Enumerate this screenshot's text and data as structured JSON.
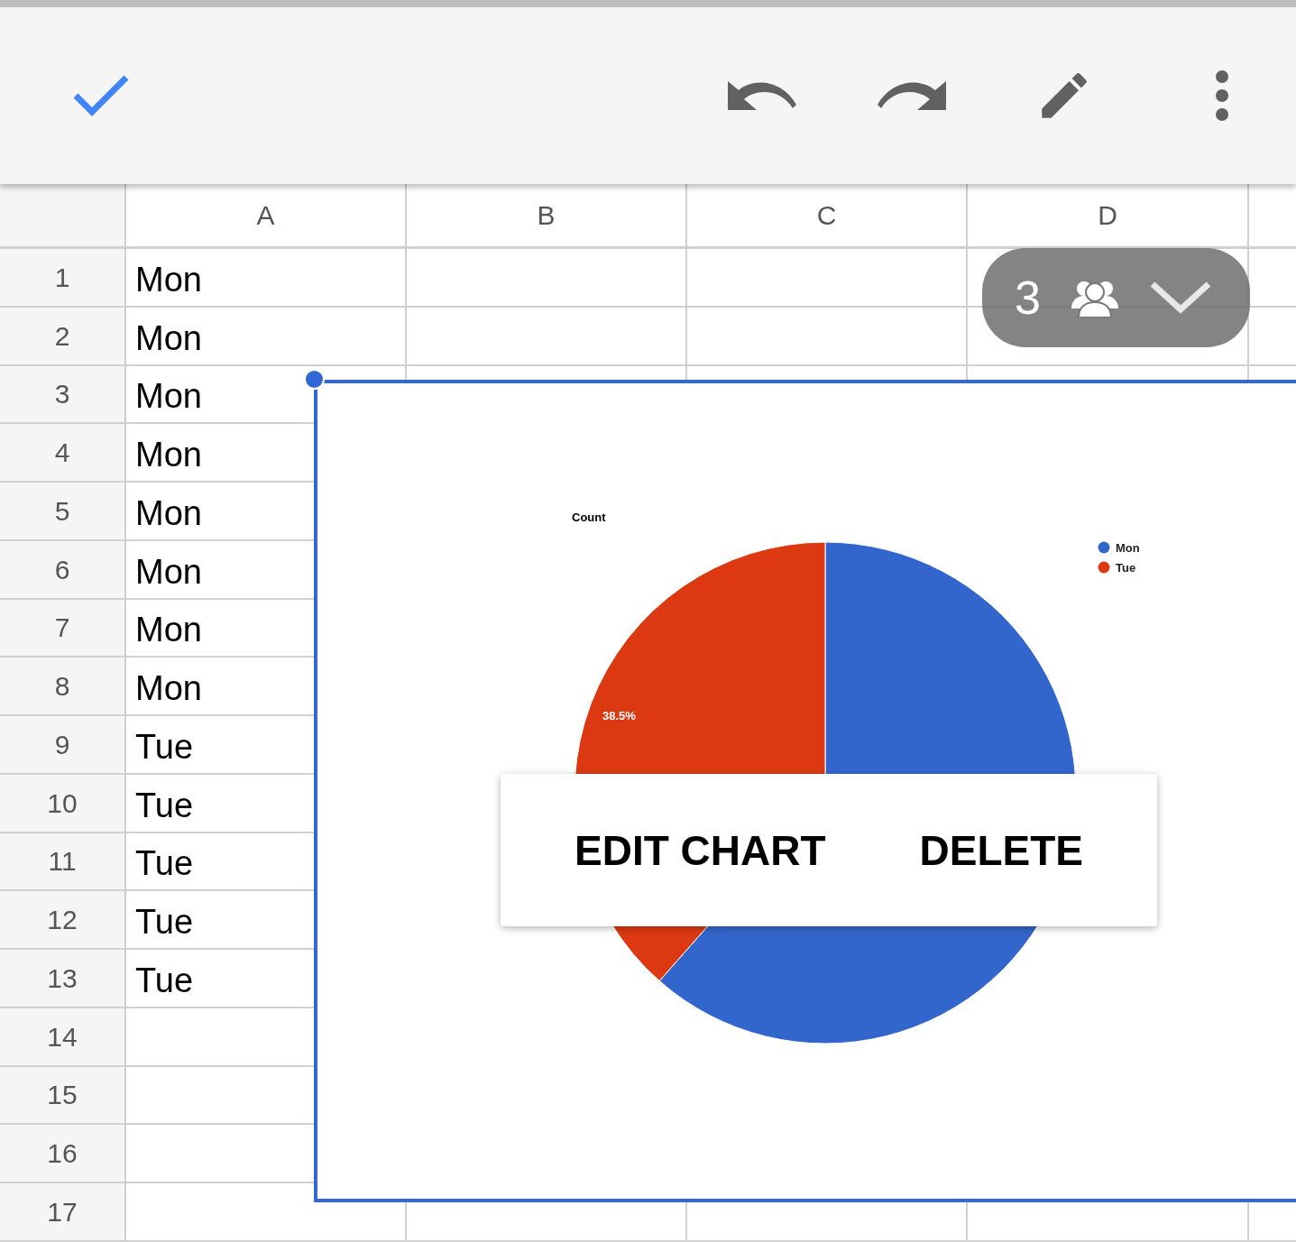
{
  "toolbar": {
    "buttons": [
      {
        "kind": "done"
      },
      {
        "kind": "undo"
      },
      {
        "kind": "redo"
      },
      {
        "kind": "edit"
      },
      {
        "kind": "more"
      }
    ]
  },
  "columns": [
    "A",
    "B",
    "C",
    "D"
  ],
  "rows": [
    {
      "number": "1",
      "a": "Mon"
    },
    {
      "number": "2",
      "a": "Mon"
    },
    {
      "number": "3",
      "a": "Mon"
    },
    {
      "number": "4",
      "a": "Mon"
    },
    {
      "number": "5",
      "a": "Mon"
    },
    {
      "number": "6",
      "a": "Mon"
    },
    {
      "number": "7",
      "a": "Mon"
    },
    {
      "number": "8",
      "a": "Mon"
    },
    {
      "number": "9",
      "a": "Tue"
    },
    {
      "number": "10",
      "a": "Tue"
    },
    {
      "number": "11",
      "a": "Tue"
    },
    {
      "number": "12",
      "a": "Tue"
    },
    {
      "number": "13",
      "a": "Tue"
    },
    {
      "number": "14"
    },
    {
      "number": "15"
    },
    {
      "number": "16"
    },
    {
      "number": "17"
    }
  ],
  "collaborators": {
    "count": "3"
  },
  "chart": {
    "chart_data": {
      "type": "pie",
      "title": "Count",
      "categories": [
        "Mon",
        "Tue"
      ],
      "colors": [
        "#3366cc",
        "#dc3912"
      ],
      "series": [
        {
          "values": [
            61.5,
            38.5
          ]
        }
      ],
      "legend": true,
      "value_labels": [
        null,
        "38.5%"
      ]
    }
  },
  "popup": {
    "buttons": [
      "EDIT CHART",
      "DELETE"
    ]
  }
}
